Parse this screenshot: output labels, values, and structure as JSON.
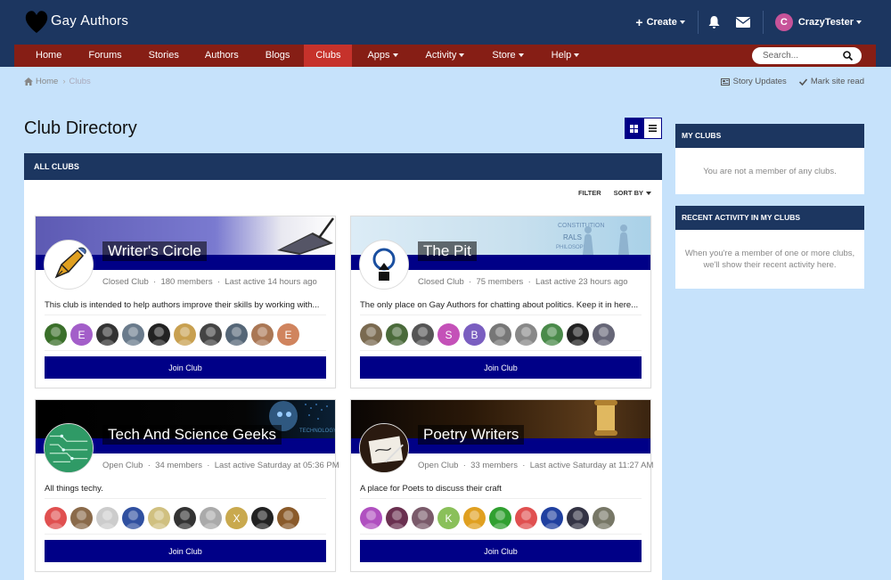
{
  "brand": {
    "name_g": "G",
    "name_rest": "ay ",
    "name_a": "A",
    "name_rest2": "uthors"
  },
  "topbar": {
    "create_label": "Create",
    "username": "CrazyTester",
    "avatar_letter": "C"
  },
  "nav": {
    "items": [
      {
        "label": "Home",
        "has_caret": false
      },
      {
        "label": "Forums",
        "has_caret": false
      },
      {
        "label": "Stories",
        "has_caret": false
      },
      {
        "label": "Authors",
        "has_caret": false
      },
      {
        "label": "Blogs",
        "has_caret": false
      },
      {
        "label": "Clubs",
        "has_caret": false,
        "active": true
      },
      {
        "label": "Apps",
        "has_caret": true
      },
      {
        "label": "Activity",
        "has_caret": true
      },
      {
        "label": "Store",
        "has_caret": true
      },
      {
        "label": "Help",
        "has_caret": true
      }
    ],
    "search_placeholder": "Search..."
  },
  "breadcrumb": {
    "home": "Home",
    "current": "Clubs"
  },
  "actions": {
    "story_updates": "Story Updates",
    "mark_read": "Mark site read"
  },
  "page": {
    "title": "Club Directory",
    "section": "ALL CLUBS",
    "filter": "FILTER",
    "sort": "SORT BY"
  },
  "clubs": [
    {
      "name": "Writer's Circle",
      "type": "Closed Club",
      "members": "180 members",
      "last_active": "Last active 14 hours ago",
      "description": "This club is intended to help authors improve their skills by working with...",
      "join": "Join Club",
      "avatars": [
        "#3a6f2a",
        "E",
        "#333",
        "#6a7b8c",
        "#222",
        "#c8a050",
        "#444",
        "#556677",
        "#aa7755",
        "E"
      ],
      "avatar_colors": [
        "#3a6f2a",
        "#a35ec9",
        "#333",
        "#6a7b8c",
        "#222",
        "#c8a050",
        "#444",
        "#556677",
        "#aa7755",
        "#d0845e"
      ]
    },
    {
      "name": "The Pit",
      "type": "Closed Club",
      "members": "75 members",
      "last_active": "Last active 23 hours ago",
      "description": "The only place on Gay Authors for chatting about politics. Keep it in here...",
      "join": "Join Club",
      "avatars": [
        "#7a6a50",
        "#4a6a3a",
        "#555",
        "S",
        "B",
        "#777",
        "#888",
        "#4a8a4a",
        "#222",
        "#667"
      ],
      "avatar_colors": [
        "#7a6a50",
        "#4a6a3a",
        "#555",
        "#c451b8",
        "#7a5ec0",
        "#777",
        "#888",
        "#4a8a4a",
        "#222",
        "#667"
      ]
    },
    {
      "name": "Tech And Science Geeks",
      "type": "Open Club",
      "members": "34 members",
      "last_active": "Last active Saturday at 05:36 PM",
      "description": "All things techy.",
      "join": "Join Club",
      "avatars": [
        "#e05050",
        "#8a6a4a",
        "#bbb",
        "#3050a0",
        "#d0c080",
        "#333",
        "#aaa",
        "X",
        "#222",
        "#8a5a2a"
      ],
      "avatar_colors": [
        "#e05050",
        "#8a6a4a",
        "#ccc",
        "#3050a0",
        "#d0c080",
        "#333",
        "#aaa",
        "#c9a94e",
        "#222",
        "#8a5a2a"
      ]
    },
    {
      "name": "Poetry Writers",
      "type": "Open Club",
      "members": "33 members",
      "last_active": "Last active Saturday at 11:27 AM",
      "description": "A place for Poets to discuss their craft",
      "join": "Join Club",
      "avatars": [
        "#b050c0",
        "#6a3050",
        "#7a5a6a",
        "K",
        "#e0a020",
        "#30a030",
        "#e05050",
        "#2040a0",
        "#334",
        "#776"
      ],
      "avatar_colors": [
        "#b050c0",
        "#6a3050",
        "#7a5a6a",
        "#8ac05a",
        "#e0a020",
        "#30a030",
        "#e05050",
        "#2040a0",
        "#334",
        "#776"
      ]
    }
  ],
  "sidebar": {
    "my_clubs_title": "MY CLUBS",
    "my_clubs_empty": "You are not a member of any clubs.",
    "recent_title": "RECENT ACTIVITY IN MY CLUBS",
    "recent_line1": "When you're a member of one or more clubs,",
    "recent_line2": "we'll show their recent activity here."
  }
}
